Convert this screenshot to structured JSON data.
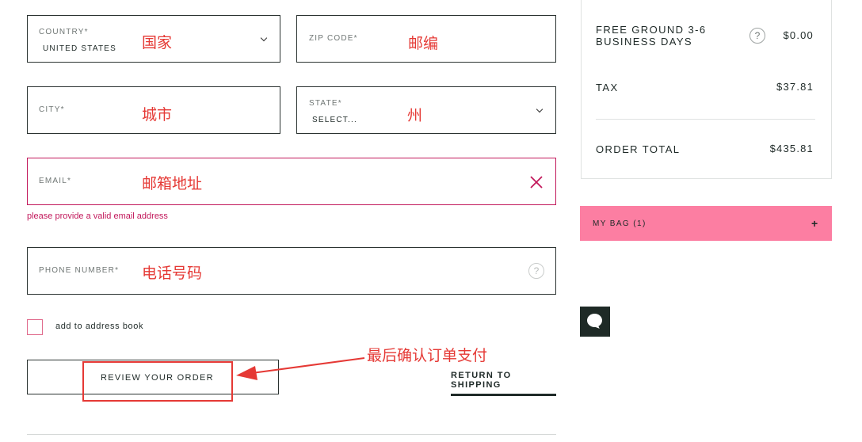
{
  "form": {
    "country": {
      "label": "COUNTRY*",
      "value": "UNITED STATES",
      "annotation": "国家"
    },
    "zip": {
      "label": "ZIP CODE*",
      "annotation": "邮编"
    },
    "city": {
      "label": "CITY*",
      "annotation": "城市"
    },
    "state": {
      "label": "STATE*",
      "value": "SELECT...",
      "annotation": "州"
    },
    "email": {
      "label": "EMAIL*",
      "annotation": "邮箱地址",
      "error": "please provide a valid email address"
    },
    "phone": {
      "label": "PHONE NUMBER*",
      "annotation": "电话号码"
    },
    "address_book_label": "add to address book",
    "review_button": "REVIEW YOUR ORDER",
    "return_link": "RETURN TO SHIPPING",
    "arrow_annotation": "最后确认订单支付"
  },
  "icons": {
    "clear": "close-icon",
    "help": "question-mark-icon",
    "dropdown": "chevron-down-icon",
    "chat": "chat-bubble-icon"
  },
  "summary": {
    "shipping_label": "FREE GROUND 3-6 BUSINESS DAYS",
    "shipping_help": "?",
    "shipping_amount": "$0.00",
    "tax_label": "TAX",
    "tax_amount": "$37.81",
    "total_label": "ORDER TOTAL",
    "total_amount": "$435.81"
  },
  "bag": {
    "label": "MY BAG (1)",
    "toggle": "+"
  },
  "colors": {
    "error": "#c2185b",
    "annotation": "#e53935",
    "bag_bar": "#fc7ea2",
    "dark": "#1e2a26"
  }
}
